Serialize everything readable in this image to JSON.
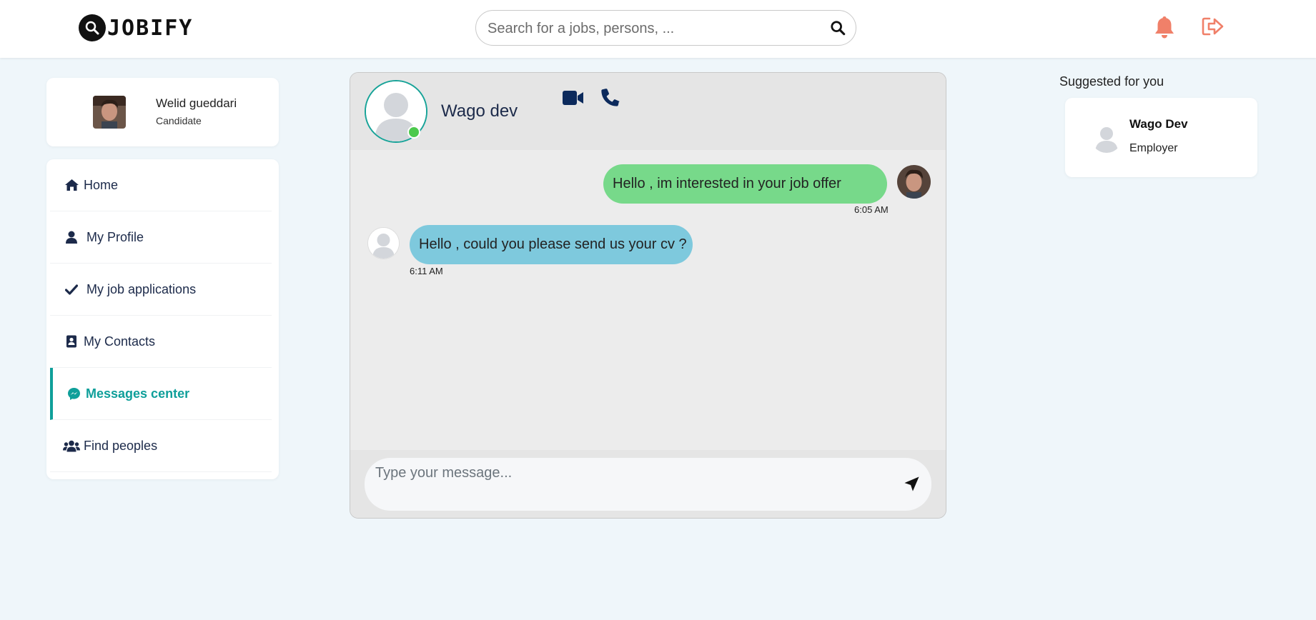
{
  "brand": {
    "logo_text": "JOBIFY",
    "icon": "magnifier-logo-icon"
  },
  "header": {
    "search_placeholder": "Search for a jobs, persons, ...",
    "search_icon": "search-icon",
    "notifications_icon": "bell-icon",
    "logout_icon": "logout-icon",
    "accent_color": "#f08069"
  },
  "profile": {
    "name": "Welid gueddari",
    "role": "Candidate"
  },
  "nav": {
    "items": [
      {
        "label": "Home",
        "icon": "home-icon"
      },
      {
        "label": "My Profile",
        "icon": "user-icon"
      },
      {
        "label": "My job applications",
        "icon": "check-icon"
      },
      {
        "label": "My Contacts",
        "icon": "address-book-icon"
      },
      {
        "label": "Messages center",
        "icon": "messenger-icon",
        "active": true
      },
      {
        "label": "Find peoples",
        "icon": "users-icon"
      }
    ],
    "active_color": "#0f9f9a"
  },
  "chat": {
    "contact_name": "Wago dev",
    "contact_status": "online",
    "messages": [
      {
        "direction": "outgoing",
        "text": "Hello , im interested in your job offer",
        "time": "6:05 AM",
        "color": "#77d98a"
      },
      {
        "direction": "incoming",
        "text": "Hello , could you please send us your cv ?",
        "time": "6:11 AM",
        "color": "#7ec9dd"
      }
    ],
    "input_placeholder": "Type your message...",
    "send_icon": "send-icon",
    "video_icon": "video-camera-icon",
    "call_icon": "phone-icon"
  },
  "suggestions": {
    "title": "Suggested for you",
    "items": [
      {
        "name": "Wago Dev",
        "role": "Employer"
      }
    ]
  }
}
